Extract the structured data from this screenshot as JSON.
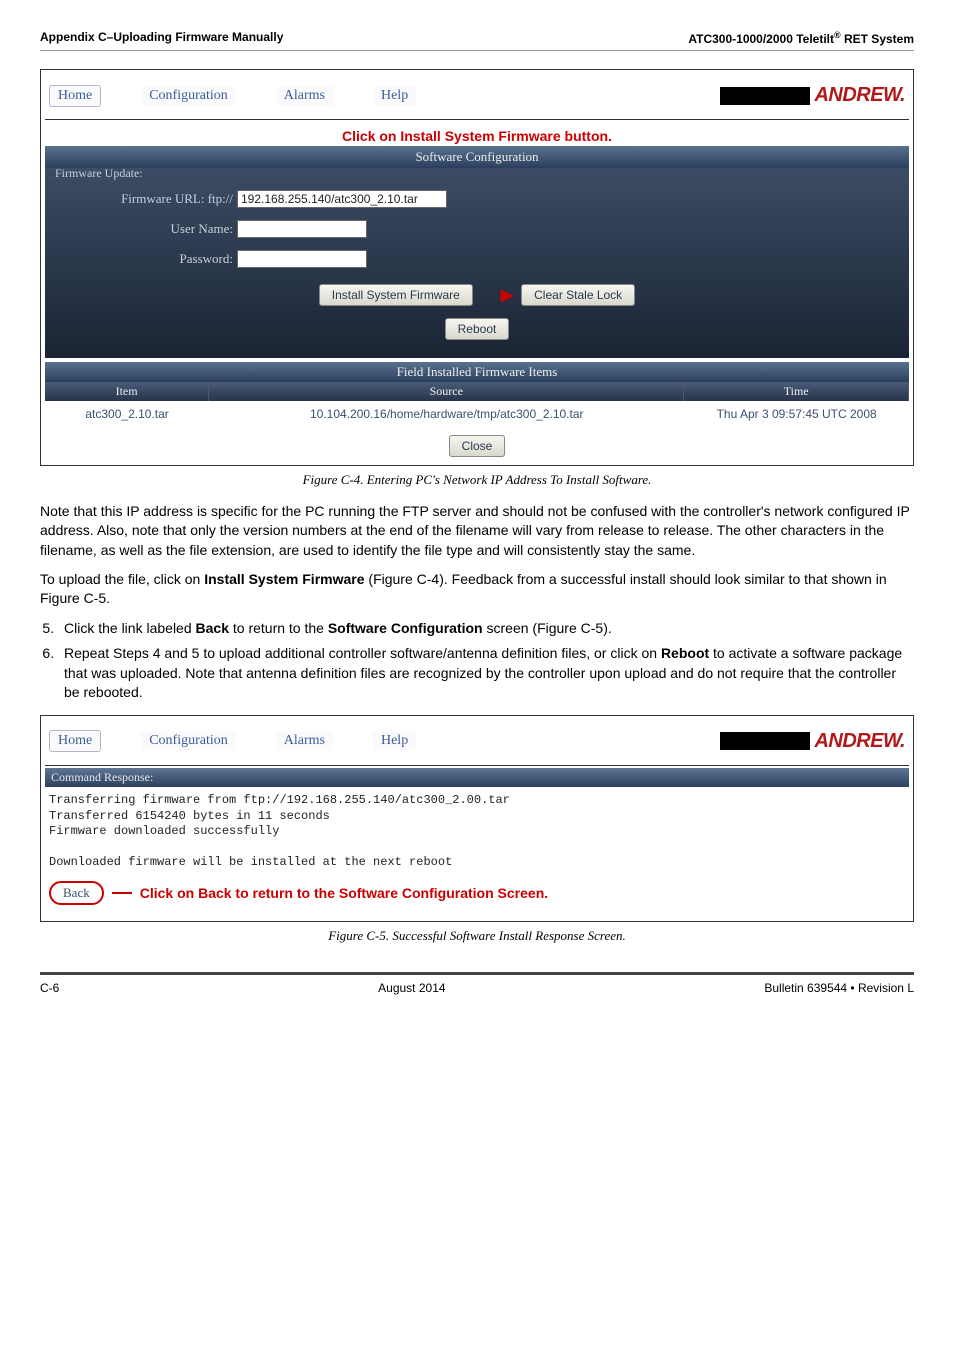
{
  "header": {
    "left": "Appendix C–Uploading Firmware Manually",
    "right_prefix": "ATC300-1000/2000 Teletilt",
    "right_sup": "®",
    "right_suffix": " RET System"
  },
  "screenshot1": {
    "tabs": {
      "home": "Home",
      "config": "Configuration",
      "alarms": "Alarms",
      "help": "Help"
    },
    "logo_text": "ANDREW.",
    "callout": "Click on Install System Firmware button.",
    "software_config_bar": "Software Configuration",
    "fw_legend": "Firmware Update:",
    "fields": {
      "url_label": "Firmware URL: ftp://",
      "url_value": "192.168.255.140/atc300_2.10.tar",
      "user_label": "User Name:",
      "user_value": "",
      "pass_label": "Password:",
      "pass_value": ""
    },
    "buttons": {
      "install": "Install System Firmware",
      "clear": "Clear Stale Lock",
      "reboot": "Reboot",
      "close": "Close"
    },
    "table": {
      "title": "Field Installed Firmware Items",
      "cols": {
        "item": "Item",
        "source": "Source",
        "time": "Time"
      },
      "row": {
        "item": "atc300_2.10.tar",
        "source": "10.104.200.16/home/hardware/tmp/atc300_2.10.tar",
        "time": "Thu Apr 3 09:57:45 UTC 2008"
      }
    }
  },
  "caption1": "Figure C-4. Entering PC's Network IP Address To Install Software.",
  "para1": "Note that this IP address is specific for the PC running the FTP server and should not be confused with the controller's network configured IP address. Also, note that only the version numbers at the end of the filename will vary from release to release. The other characters in the filename, as well as the file extension, are used to identify the file type and will consistently stay the same.",
  "para2_pre": "To upload the file, click on ",
  "para2_bold": "Install System Firmware",
  "para2_post": " (Figure C‑4). Feedback from a successful install should look similar to that shown in Figure C‑5.",
  "step5": {
    "pre": "Click the link labeled ",
    "b1": "Back",
    "mid": " to return to the ",
    "b2": "Software Configuration",
    "post": " screen (Figure C‑5)."
  },
  "step6": {
    "pre": "Repeat Steps 4 and 5 to upload additional controller software/antenna definition files, or click on ",
    "b1": "Reboot",
    "post": " to activate a software package that was uploaded. Note that antenna definition files are recognized by the controller upon upload and do not require that the controller be rebooted."
  },
  "screenshot2": {
    "tabs": {
      "home": "Home",
      "config": "Configuration",
      "alarms": "Alarms",
      "help": "Help"
    },
    "logo_text": "ANDREW.",
    "cmd_bar": "Command Response:",
    "lines": [
      "Transferring firmware from ftp://192.168.255.140/atc300_2.00.tar",
      "Transferred 6154240 bytes in 11 seconds",
      "Firmware downloaded successfully",
      "",
      "Downloaded firmware will be installed at the next reboot"
    ],
    "back_label": "Back",
    "back_callout_pre": "Click on ",
    "back_callout_b1": "Back",
    "back_callout_mid": " to return to the ",
    "back_callout_b2": "Software Configuration",
    "back_callout_post": " Screen."
  },
  "caption2": "Figure C-5. Successful Software Install Response Screen.",
  "footer": {
    "left": "C-6",
    "center": "August 2014",
    "right": "Bulletin 639544  •  Revision L"
  }
}
